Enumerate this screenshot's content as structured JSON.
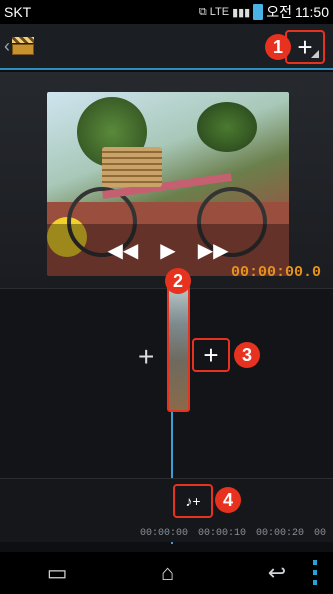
{
  "status": {
    "carrier": "SKT",
    "network": "LTE",
    "ampm": "오전",
    "time": "11:50"
  },
  "actionbar": {
    "back_glyph": "‹",
    "app_icon": "clapperboard-icon",
    "add_media_glyph": "+",
    "badge_1": "1"
  },
  "player": {
    "rewind_glyph": "◀◀",
    "play_glyph": "▶",
    "ffwd_glyph": "▶▶",
    "timecode": "00:00:00.0"
  },
  "timeline": {
    "badge_2": "2",
    "badge_3": "3",
    "badge_4": "4",
    "add_left_glyph": "+",
    "add_clip_glyph": "+",
    "add_audio_glyph": "♪+",
    "ruler": [
      "00:00:00",
      "00:00:10",
      "00:00:20",
      "00"
    ]
  },
  "navbar": {
    "recent_glyph": "▭",
    "home_glyph": "⌂",
    "back_glyph": "↩"
  }
}
